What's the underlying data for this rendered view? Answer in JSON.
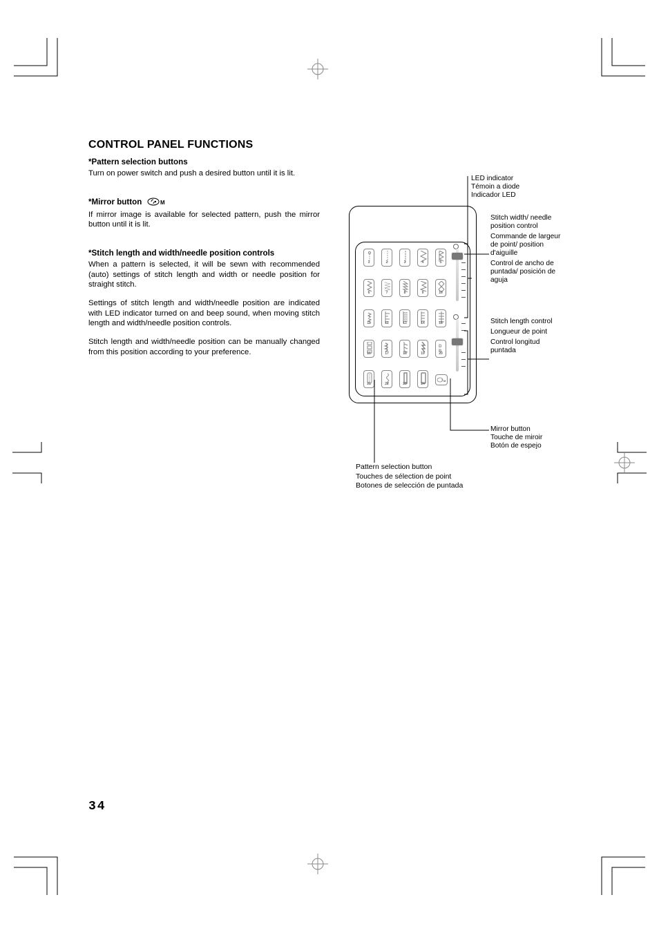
{
  "page_number": "34",
  "title": "CONTROL PANEL FUNCTIONS",
  "sections": {
    "pattern": {
      "heading": "*Pattern selection buttons",
      "body": "Turn on power switch and push a desired button until it is lit."
    },
    "mirror": {
      "heading": "*Mirror button",
      "body": "If mirror image is available for selected pattern, push the mirror button until it is lit."
    },
    "stitch": {
      "heading": "*Stitch length and width/needle position controls",
      "p1": "When a pattern is selected, it will be sewn with recommended (auto) settings of stitch length and width or needle position for straight stitch.",
      "p2": "Settings of stitch length and width/needle position are indicated with LED indicator turned on and beep sound, when moving stitch length and width/needle position controls.",
      "p3": "Stitch length and width/needle position can be manually changed from this position according to your preference."
    }
  },
  "buttons": [
    "1",
    "2",
    "3",
    "4",
    "5",
    "6",
    "7",
    "8",
    "9",
    "10",
    "11",
    "12",
    "13",
    "14",
    "15",
    "16",
    "17",
    "18",
    "19",
    "20",
    "21",
    "22",
    "23",
    "24"
  ],
  "mirror_symbol": "M",
  "annotations": {
    "led": {
      "en": "LED indicator",
      "fr": "Témoin a diode",
      "es": "Indicador LED"
    },
    "width": {
      "en": "Stitch width/ needle position control",
      "fr": "Commande de largeur de point/ position d'aiguille",
      "es": "Control de ancho de puntada/ posición de aguja"
    },
    "length": {
      "en": "Stitch length control",
      "fr": "Longueur de point",
      "es": "Control longitud puntada"
    },
    "mirrorbtn": {
      "en": "Mirror button",
      "fr": "Touche de miroir",
      "es": "Botón de espejo"
    },
    "pattern": {
      "en": "Pattern selection button",
      "fr": "Touches de sélection de point",
      "es": "Botones de selección de puntada"
    }
  }
}
